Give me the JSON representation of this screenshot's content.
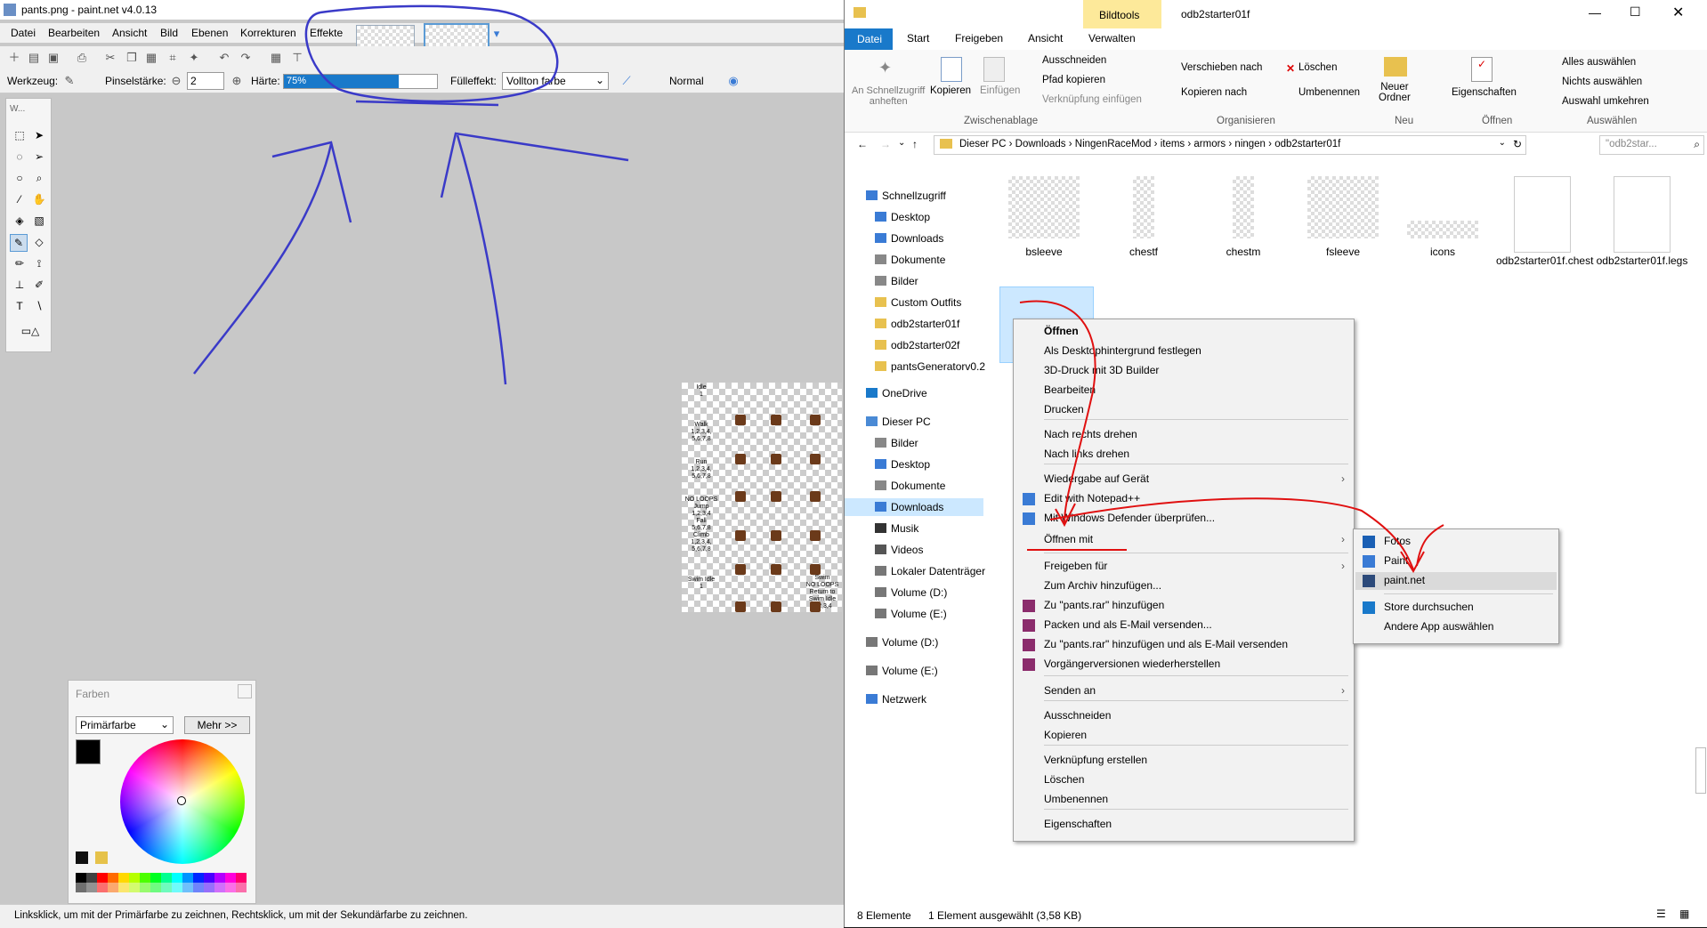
{
  "paintnet": {
    "title": "pants.png - paint.net v4.0.13",
    "menu": [
      "Datei",
      "Bearbeiten",
      "Ansicht",
      "Bild",
      "Ebenen",
      "Korrekturen",
      "Effekte"
    ],
    "options": {
      "tool_label": "Werkzeug:",
      "brush_size_label": "Pinselstärke:",
      "brush_size_value": "2",
      "hardness_label": "Härte:",
      "hardness_value": "75%",
      "hardness_level": 0.75,
      "fill_label": "Fülleffekt:",
      "fill_value": "Vollton farbe",
      "blend_mode": "Normal"
    },
    "toolbox_title": "W...",
    "canvas_labels": [
      "Idle\n1",
      "Walk\n1,2,3,4,\n5,6,7,8",
      "Run\n1,2,3,4,\n5,6,7,8",
      "NO LOOPS\nJump\n1,2,3,4\nFall\n5,6,7,8\nClimb\n1,2,3,4,\n5,6,7,8",
      "Swim Idle\n1",
      "Swim\nNO LOOPS\nReturn to\nSwim Idle\n1,2,3,4"
    ],
    "colors": {
      "title": "Farben",
      "mode": "Primärfarbe",
      "more_button": "Mehr >>"
    },
    "status": "Linksklick, um mit der Primärfarbe zu zeichnen, Rechtsklick, um mit der Sekundärfarbe zu zeichnen."
  },
  "explorer": {
    "title": "odb2starter01f",
    "context_tab": "Bildtools",
    "tabs": [
      "Datei",
      "Start",
      "Freigeben",
      "Ansicht",
      "Verwalten"
    ],
    "ribbon": {
      "pin": "An Schnellzugriff\nanheften",
      "copy": "Kopieren",
      "paste": "Einfügen",
      "cut": "Ausschneiden",
      "copy_path": "Pfad kopieren",
      "paste_shortcut": "Verknüpfung einfügen",
      "move_to": "Verschieben nach",
      "copy_to": "Kopieren nach",
      "delete": "Löschen",
      "rename": "Umbenennen",
      "new_folder": "Neuer\nOrdner",
      "properties": "Eigenschaften",
      "select_all": "Alles auswählen",
      "select_none": "Nichts auswählen",
      "invert_selection": "Auswahl umkehren",
      "groups": [
        "Zwischenablage",
        "Organisieren",
        "Neu",
        "Öffnen",
        "Auswählen"
      ]
    },
    "breadcrumb": [
      "Dieser PC",
      "Downloads",
      "NingenRaceMod",
      "items",
      "armors",
      "ningen",
      "odb2starter01f"
    ],
    "search_placeholder": "\"odb2star...",
    "nav": [
      "Schnellzugriff",
      "Desktop",
      "Downloads",
      "Dokumente",
      "Bilder",
      "Custom Outfits",
      "odb2starter01f",
      "odb2starter02f",
      "pantsGeneratorv0.2",
      "OneDrive",
      "Dieser PC",
      "Bilder",
      "Desktop",
      "Dokumente",
      "Downloads",
      "Musik",
      "Videos",
      "Lokaler Datenträger",
      "Volume (D:)",
      "Volume (E:)",
      "Volume (D:)",
      "Volume (E:)",
      "Netzwerk"
    ],
    "files": [
      "bsleeve",
      "chestf",
      "chestm",
      "fsleeve",
      "icons",
      "odb2starter01f.chest",
      "odb2starter01f.legs"
    ],
    "status_count": "8 Elemente",
    "status_selected": "1 Element ausgewählt (3,58 KB)"
  },
  "context_menu": {
    "items": [
      "Öffnen",
      "Als Desktophintergrund festlegen",
      "3D-Druck mit 3D Builder",
      "Bearbeiten",
      "Drucken",
      "Nach rechts drehen",
      "Nach links drehen",
      "Wiedergabe auf Gerät",
      "Edit with Notepad++",
      "Mit Windows Defender überprüfen...",
      "Öffnen mit",
      "Freigeben für",
      "Zum Archiv hinzufügen...",
      "Zu \"pants.rar\" hinzufügen",
      "Packen und als E-Mail versenden...",
      "Zu \"pants.rar\" hinzufügen und als E-Mail versenden",
      "Vorgängerversionen wiederherstellen",
      "Senden an",
      "Ausschneiden",
      "Kopieren",
      "Verknüpfung erstellen",
      "Löschen",
      "Umbenennen",
      "Eigenschaften"
    ],
    "submenu": [
      "Fotos",
      "Paint",
      "paint.net",
      "Store durchsuchen",
      "Andere App auswählen"
    ]
  },
  "colors_used": {
    "annotation_blue": "#3a3ac8",
    "annotation_red": "#e01010",
    "accent": "#1979ca",
    "selection": "#cce8ff"
  }
}
